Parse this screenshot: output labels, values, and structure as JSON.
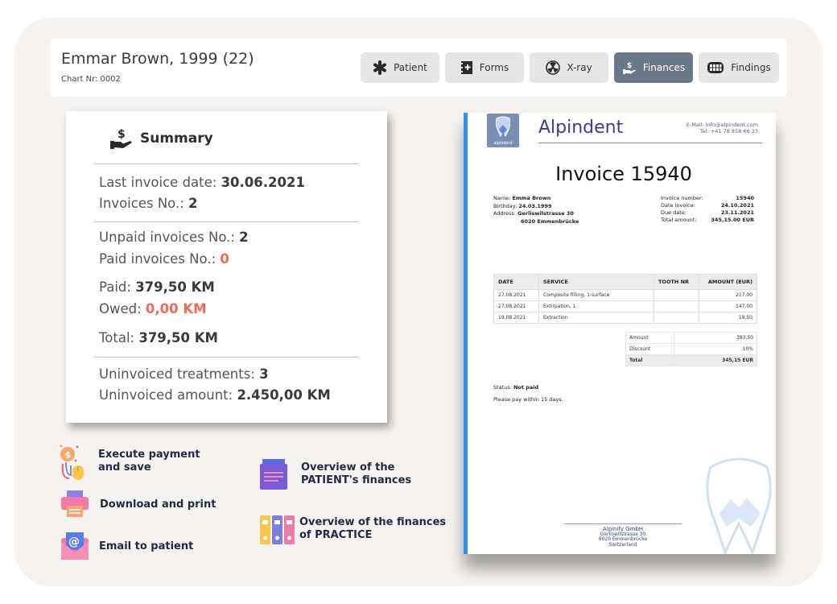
{
  "header": {
    "patient_name": "Emmar Brown, 1999 (22)",
    "chart_label": "Chart Nr:",
    "chart_number": "0002"
  },
  "tabs": [
    {
      "label": "Patient",
      "icon": "asterisk-icon",
      "active": false
    },
    {
      "label": "Forms",
      "icon": "forms-icon",
      "active": false
    },
    {
      "label": "X-ray",
      "icon": "radiation-icon",
      "active": false
    },
    {
      "label": "Finances",
      "icon": "hand-dollar-icon",
      "active": true
    },
    {
      "label": "Findings",
      "icon": "teeth-icon",
      "active": false
    }
  ],
  "summary": {
    "title": "Summary",
    "last_invoice_label": "Last invoice date: ",
    "last_invoice_value": "30.06.2021",
    "invoices_label": "Invoices No.: ",
    "invoices_value": "2",
    "unpaid_label": "Unpaid invoices No.: ",
    "unpaid_value": "2",
    "paid_no_label": "Paid invoices No.: ",
    "paid_no_value": "0",
    "paid_label": "Paid: ",
    "paid_value": "379,50 KM",
    "owed_label": "Owed: ",
    "owed_value": "0,00 KM",
    "total_label": "Total: ",
    "total_value": "379,50 KM",
    "uninvoiced_treat_label": "Uninvoiced treatments: ",
    "uninvoiced_treat_value": "3",
    "uninvoiced_amount_label": "Uninvoiced amount: ",
    "uninvoiced_amount_value": "2.450,00 KM"
  },
  "actions": {
    "execute_payment": "Execute payment\nand save",
    "download_print": "Download and print",
    "email_patient": "Email to patient",
    "patient_finances": "Overview of the\nPATIENT's finances",
    "practice_finances": "Overview of the finances\nof PRACTICE"
  },
  "invoice": {
    "logo_text": "alpindent",
    "brand": "Alpindent",
    "email": "E-Mail: info@alpindent.com",
    "tel": "Tel: +41 78 858 66 33",
    "title": "Invoice 15940",
    "name_label": "Name: ",
    "name_value": "Emma Brown",
    "birthday_label": "Birthday: ",
    "birthday_value": "24.03.1999",
    "address_label": "Address: ",
    "address_line1": "Gerliswilstrasse 30",
    "address_line2": "6020 Emmenbrücke",
    "number_label": "Invoice number:",
    "number_value": "15940",
    "date_label": "Date invoice:",
    "date_value": "24.10.2021",
    "due_label": "Due date:",
    "due_value": "23.11.2021",
    "amount_label": "Total amount:",
    "amount_value": "345,15.00 EUR",
    "columns": [
      "DATE",
      "SERVICE",
      "TOOTH NR",
      "AMOUNT (EUR)"
    ],
    "rows": [
      {
        "date": "27.08.2021",
        "service": "Composite filling, 1-surface",
        "tooth": "",
        "amount": "217,00"
      },
      {
        "date": "27.08.2021",
        "service": "Extirpation, 1",
        "tooth": "",
        "amount": "147,00"
      },
      {
        "date": "19.08.2021",
        "service": "Extraction",
        "tooth": "",
        "amount": "19,50"
      }
    ],
    "totals": [
      {
        "label": "Amount",
        "value": "383,50"
      },
      {
        "label": "Discount",
        "value": "10%"
      },
      {
        "label": "Total",
        "value": "345,15 EUR"
      }
    ],
    "status_label": "Status: ",
    "status_value": "Not paid",
    "note": "Please pay within 15 days.",
    "footer_company": "Alpinify GmbH",
    "footer_street": "Gerliswilstrasse 30",
    "footer_city": "6020 Emmenbrücke",
    "footer_country": "Switzerland"
  },
  "colors": {
    "background": "#f6f3ee",
    "active_tab": "#6b7889",
    "accent_red": "#ef6b5a",
    "invoice_border": "#2f8ff0",
    "brand_blue": "#3b3f86",
    "action_text": "#1e2a4a"
  }
}
